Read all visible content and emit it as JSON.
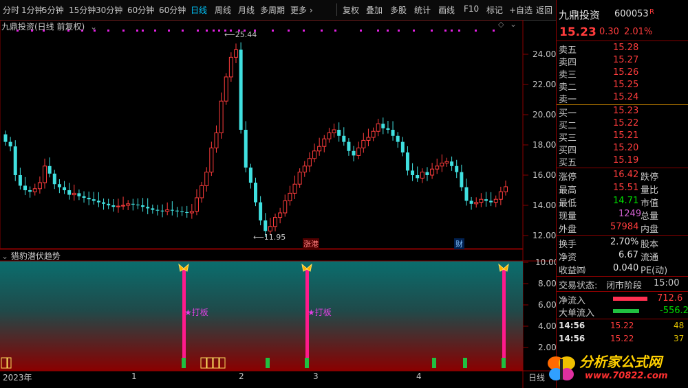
{
  "toolbar": {
    "periods": [
      "分时",
      "1分钟",
      "5分钟",
      "15分钟",
      "30分钟",
      "60分钟",
      "日线",
      "周线",
      "月线",
      "多周期",
      "更多 ›"
    ],
    "active_period": "日线",
    "actions": [
      "复权",
      "叠加",
      "多股",
      "统计",
      "画线",
      "F10",
      "标记",
      "+自选",
      "返回"
    ]
  },
  "chart": {
    "title": "九鼎投资(日线 前复权)",
    "high_label": "25.44",
    "low_label": "11.95",
    "y_ticks": [
      "24.00",
      "22.00",
      "20.00",
      "18.00",
      "16.00",
      "14.00",
      "12.00"
    ],
    "event_tags": [
      "涨港",
      "财"
    ]
  },
  "indicator": {
    "title": "猎豹潜伏趋势",
    "signal_label": "★打板",
    "y_ticks": [
      "10.00",
      "8.00",
      "6.00",
      "4.00",
      "2.00"
    ]
  },
  "xaxis": {
    "labels": [
      "2023年",
      "1",
      "2",
      "3",
      "4"
    ],
    "right_label": "日线"
  },
  "quote": {
    "name": "九鼎投资",
    "code": "600053",
    "flag": "R",
    "price": "15.23",
    "change": "0.30",
    "change_pct": "2.01%",
    "asks": [
      {
        "label": "卖五",
        "price": "15.28"
      },
      {
        "label": "卖四",
        "price": "15.27"
      },
      {
        "label": "卖三",
        "price": "15.26"
      },
      {
        "label": "卖二",
        "price": "15.25"
      },
      {
        "label": "卖一",
        "price": "15.24"
      }
    ],
    "bids": [
      {
        "label": "买一",
        "price": "15.23"
      },
      {
        "label": "买二",
        "price": "15.22"
      },
      {
        "label": "买三",
        "price": "15.21"
      },
      {
        "label": "买四",
        "price": "15.20"
      },
      {
        "label": "买五",
        "price": "15.19"
      }
    ],
    "stats": [
      {
        "label": "涨停",
        "value": "16.42",
        "label2": "跌停"
      },
      {
        "label": "最高",
        "value": "15.51",
        "label2": "量比"
      },
      {
        "label": "最低",
        "value": "14.71",
        "label2": "市值"
      },
      {
        "label": "现量",
        "value": "1249",
        "label2": "总量"
      },
      {
        "label": "外盘",
        "value": "57984",
        "label2": "内盘"
      }
    ],
    "fund": [
      {
        "label": "换手",
        "value": "2.70%",
        "label2": "股本"
      },
      {
        "label": "净资",
        "value": "6.67",
        "label2": "流通"
      },
      {
        "label": "收益㈣",
        "value": "0.040",
        "label2": "PE(动)"
      }
    ],
    "status_label": "交易状态:",
    "status_value": "闭市阶段",
    "status_time": "15:00",
    "flows": [
      {
        "label": "净流入",
        "value": "712.6"
      },
      {
        "label": "大单流入",
        "value": "-556.2"
      }
    ],
    "ticks": [
      {
        "time": "14:56",
        "price": "15.22",
        "vol": "48"
      },
      {
        "time": "14:56",
        "price": "15.22",
        "vol": "37"
      }
    ]
  },
  "watermark": {
    "title": "分析家公式网",
    "url": "www.70822.com"
  }
}
